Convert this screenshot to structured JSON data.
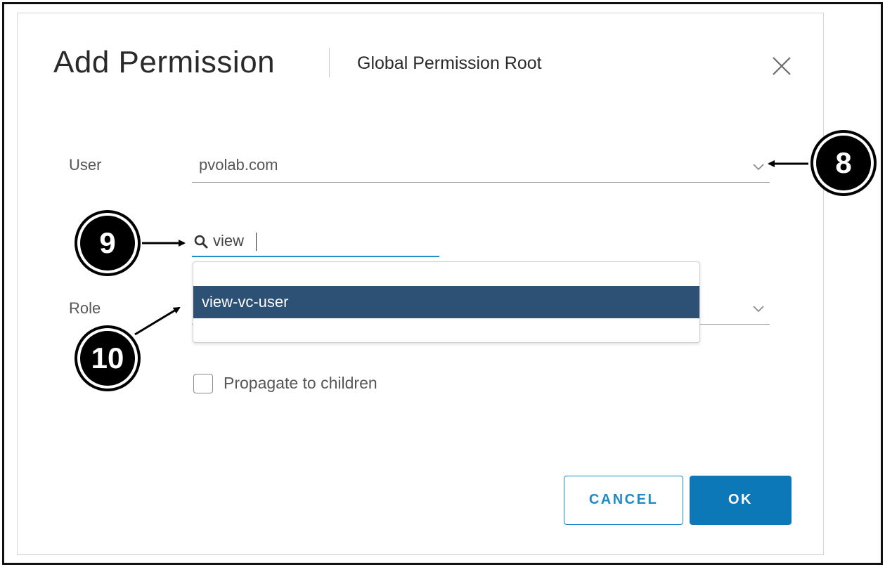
{
  "dialog": {
    "title": "Add Permission",
    "subtitle": "Global Permission Root"
  },
  "user_field": {
    "label": "User",
    "value": "pvolab.com"
  },
  "search": {
    "value": "view"
  },
  "dropdown": {
    "items": [
      {
        "label": "view-vc-user",
        "selected": true
      }
    ]
  },
  "role_field": {
    "label": "Role"
  },
  "propagate": {
    "label": "Propagate to children",
    "checked": false
  },
  "buttons": {
    "cancel_label": "CANCEL",
    "ok_label": "OK"
  },
  "callouts": {
    "user_dropdown": "8",
    "search": "9",
    "result": "10"
  },
  "icons": {
    "close": "close-icon",
    "chevron": "chevron-down-icon",
    "search": "search-icon"
  },
  "colors": {
    "accent": "#0c78b8",
    "selected_item": "#2c5175",
    "search_underline": "#1d8fc7"
  }
}
